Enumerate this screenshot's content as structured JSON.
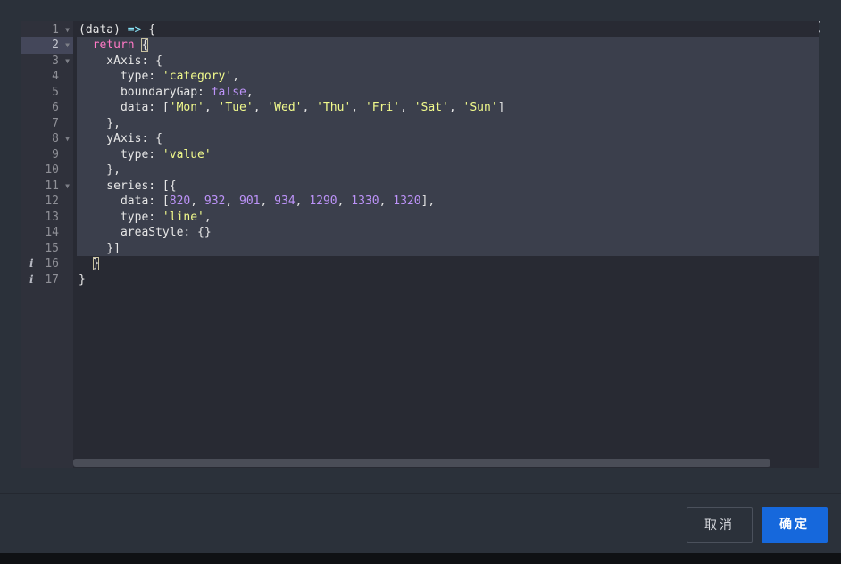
{
  "dialog": {
    "close_icon": "close-icon",
    "buttons": {
      "cancel": "取消",
      "ok": "确定"
    }
  },
  "editor": {
    "active_line": 2,
    "lines": [
      {
        "num": "1",
        "fold": true,
        "info": false
      },
      {
        "num": "2",
        "fold": true,
        "info": false
      },
      {
        "num": "3",
        "fold": true,
        "info": false
      },
      {
        "num": "4",
        "fold": false,
        "info": false
      },
      {
        "num": "5",
        "fold": false,
        "info": false
      },
      {
        "num": "6",
        "fold": false,
        "info": false
      },
      {
        "num": "7",
        "fold": false,
        "info": false
      },
      {
        "num": "8",
        "fold": true,
        "info": false
      },
      {
        "num": "9",
        "fold": false,
        "info": false
      },
      {
        "num": "10",
        "fold": false,
        "info": false
      },
      {
        "num": "11",
        "fold": true,
        "info": false
      },
      {
        "num": "12",
        "fold": false,
        "info": false
      },
      {
        "num": "13",
        "fold": false,
        "info": false
      },
      {
        "num": "14",
        "fold": false,
        "info": false
      },
      {
        "num": "15",
        "fold": false,
        "info": false
      },
      {
        "num": "16",
        "fold": false,
        "info": true
      },
      {
        "num": "17",
        "fold": false,
        "info": true
      }
    ],
    "code": [
      [
        [
          "plain",
          "(data) "
        ],
        [
          "op",
          "=>"
        ],
        [
          "plain",
          " {"
        ]
      ],
      [
        [
          "plain",
          "  "
        ],
        [
          "kw",
          "return"
        ],
        [
          "plain",
          " "
        ],
        [
          "brace",
          "{"
        ]
      ],
      [
        [
          "plain",
          "    xAxis: {"
        ]
      ],
      [
        [
          "plain",
          "      type: "
        ],
        [
          "str",
          "'category'"
        ],
        [
          "plain",
          ","
        ]
      ],
      [
        [
          "plain",
          "      boundaryGap: "
        ],
        [
          "bool",
          "false"
        ],
        [
          "plain",
          ","
        ]
      ],
      [
        [
          "plain",
          "      data: ["
        ],
        [
          "str",
          "'Mon'"
        ],
        [
          "plain",
          ", "
        ],
        [
          "str",
          "'Tue'"
        ],
        [
          "plain",
          ", "
        ],
        [
          "str",
          "'Wed'"
        ],
        [
          "plain",
          ", "
        ],
        [
          "str",
          "'Thu'"
        ],
        [
          "plain",
          ", "
        ],
        [
          "str",
          "'Fri'"
        ],
        [
          "plain",
          ", "
        ],
        [
          "str",
          "'Sat'"
        ],
        [
          "plain",
          ", "
        ],
        [
          "str",
          "'Sun'"
        ],
        [
          "plain",
          "]"
        ]
      ],
      [
        [
          "plain",
          "    },"
        ]
      ],
      [
        [
          "plain",
          "    yAxis: {"
        ]
      ],
      [
        [
          "plain",
          "      type: "
        ],
        [
          "str",
          "'value'"
        ]
      ],
      [
        [
          "plain",
          "    },"
        ]
      ],
      [
        [
          "plain",
          "    series: [{"
        ]
      ],
      [
        [
          "plain",
          "      data: ["
        ],
        [
          "num",
          "820"
        ],
        [
          "plain",
          ", "
        ],
        [
          "num",
          "932"
        ],
        [
          "plain",
          ", "
        ],
        [
          "num",
          "901"
        ],
        [
          "plain",
          ", "
        ],
        [
          "num",
          "934"
        ],
        [
          "plain",
          ", "
        ],
        [
          "num",
          "1290"
        ],
        [
          "plain",
          ", "
        ],
        [
          "num",
          "1330"
        ],
        [
          "plain",
          ", "
        ],
        [
          "num",
          "1320"
        ],
        [
          "plain",
          "],"
        ]
      ],
      [
        [
          "plain",
          "      type: "
        ],
        [
          "str",
          "'line'"
        ],
        [
          "plain",
          ","
        ]
      ],
      [
        [
          "plain",
          "      areaStyle: {}"
        ]
      ],
      [
        [
          "plain",
          "    }]"
        ]
      ],
      [
        [
          "plain",
          "  "
        ],
        [
          "brace",
          "}"
        ]
      ],
      [
        [
          "plain",
          "}"
        ]
      ]
    ]
  },
  "colors": {
    "keyword": "#ff79c6",
    "string": "#f1fa8c",
    "number": "#bd93f9",
    "primary_button": "#1668dc"
  }
}
